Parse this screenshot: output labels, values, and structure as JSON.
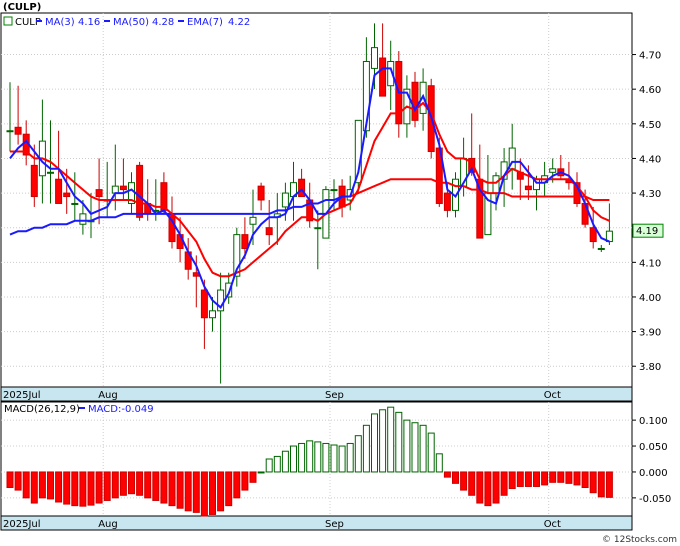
{
  "header": {
    "ticker": "(CULP)",
    "legend": [
      {
        "label": "CULP",
        "color": "#008000"
      },
      {
        "label": "MA(3)",
        "value": "4.16",
        "color": "#1a1aff"
      },
      {
        "label": "MA(50)",
        "value": "4.28",
        "color": "#1a1aff"
      },
      {
        "label": "EMA(7)",
        "value": "4.22",
        "color": "#1a1aff"
      }
    ]
  },
  "price_tag": "4.19",
  "macd_legend": {
    "label": "MACD(26,12,9)",
    "value_label": "MACD:-0.049"
  },
  "watermark": "© 12Stocks.com",
  "colors": {
    "up": "#006400",
    "down": "#ff0000",
    "ma_fast": "#1a1aff",
    "ema": "#ff0000",
    "macd_pos": "#006400",
    "macd_neg": "#ff0000",
    "tag_bg": "#d8ffd8",
    "axis_band": "#c8e6f0"
  },
  "chart_data": [
    {
      "type": "candlestick",
      "title": "(CULP)",
      "x_labels": [
        {
          "label": "2025Jul",
          "index": 0
        },
        {
          "label": "Aug",
          "index": 12
        },
        {
          "label": "Sep",
          "index": 40
        },
        {
          "label": "Oct",
          "index": 67
        }
      ],
      "ylim": [
        3.74,
        4.82
      ],
      "y_ticks": [
        3.8,
        3.9,
        4.0,
        4.1,
        4.2,
        4.3,
        4.4,
        4.5,
        4.6,
        4.7
      ],
      "ohlc": [
        [
          4.48,
          4.62,
          4.42,
          4.48
        ],
        [
          4.49,
          4.61,
          4.44,
          4.47
        ],
        [
          4.47,
          4.51,
          4.38,
          4.41
        ],
        [
          4.38,
          4.44,
          4.26,
          4.29
        ],
        [
          4.35,
          4.57,
          4.27,
          4.45
        ],
        [
          4.36,
          4.51,
          4.27,
          4.36
        ],
        [
          4.34,
          4.48,
          4.29,
          4.27
        ],
        [
          4.3,
          4.37,
          4.24,
          4.29
        ],
        [
          4.27,
          4.36,
          4.22,
          4.27
        ],
        [
          4.21,
          4.28,
          4.18,
          4.24
        ],
        [
          4.22,
          4.3,
          4.17,
          4.22
        ],
        [
          4.31,
          4.4,
          4.21,
          4.29
        ],
        [
          4.28,
          4.39,
          4.23,
          4.28
        ],
        [
          4.3,
          4.44,
          4.25,
          4.32
        ],
        [
          4.32,
          4.4,
          4.28,
          4.31
        ],
        [
          4.27,
          4.36,
          4.24,
          4.33
        ],
        [
          4.38,
          4.39,
          4.22,
          4.23
        ],
        [
          4.27,
          4.34,
          4.22,
          4.24
        ],
        [
          4.25,
          4.34,
          4.22,
          4.25
        ],
        [
          4.33,
          4.36,
          4.24,
          4.25
        ],
        [
          4.24,
          4.29,
          4.14,
          4.16
        ],
        [
          4.18,
          4.23,
          4.1,
          4.14
        ],
        [
          4.13,
          4.17,
          4.05,
          4.08
        ],
        [
          4.07,
          4.12,
          3.97,
          4.06
        ],
        [
          4.02,
          4.05,
          3.85,
          3.94
        ],
        [
          3.94,
          4.0,
          3.9,
          3.96
        ],
        [
          3.96,
          4.07,
          3.75,
          4.02
        ],
        [
          4.0,
          4.07,
          3.98,
          4.04
        ],
        [
          4.06,
          4.2,
          4.03,
          4.18
        ],
        [
          4.18,
          4.23,
          4.11,
          4.14
        ],
        [
          4.21,
          4.31,
          4.15,
          4.23
        ],
        [
          4.32,
          4.33,
          4.25,
          4.28
        ],
        [
          4.2,
          4.28,
          4.15,
          4.18
        ],
        [
          4.23,
          4.3,
          4.15,
          4.24
        ],
        [
          4.26,
          4.33,
          4.22,
          4.3
        ],
        [
          4.29,
          4.39,
          4.22,
          4.33
        ],
        [
          4.34,
          4.37,
          4.29,
          4.29
        ],
        [
          4.28,
          4.33,
          4.2,
          4.22
        ],
        [
          4.2,
          4.25,
          4.08,
          4.2
        ],
        [
          4.17,
          4.32,
          4.17,
          4.31
        ],
        [
          4.31,
          4.34,
          4.25,
          4.31
        ],
        [
          4.32,
          4.34,
          4.23,
          4.26
        ],
        [
          4.28,
          4.35,
          4.25,
          4.31
        ],
        [
          4.33,
          4.5,
          4.3,
          4.51
        ],
        [
          4.48,
          4.75,
          4.46,
          4.68
        ],
        [
          4.66,
          4.79,
          4.6,
          4.72
        ],
        [
          4.69,
          4.79,
          4.58,
          4.58
        ],
        [
          4.61,
          4.74,
          4.54,
          4.68
        ],
        [
          4.68,
          4.71,
          4.46,
          4.5
        ],
        [
          4.5,
          4.64,
          4.46,
          4.6
        ],
        [
          4.62,
          4.65,
          4.49,
          4.51
        ],
        [
          4.53,
          4.66,
          4.48,
          4.62
        ],
        [
          4.61,
          4.63,
          4.4,
          4.42
        ],
        [
          4.43,
          4.46,
          4.26,
          4.27
        ],
        [
          4.3,
          4.33,
          4.23,
          4.25
        ],
        [
          4.25,
          4.36,
          4.23,
          4.34
        ],
        [
          4.32,
          4.46,
          4.29,
          4.4
        ],
        [
          4.4,
          4.53,
          4.35,
          4.36
        ],
        [
          4.34,
          4.44,
          4.17,
          4.17
        ],
        [
          4.18,
          4.41,
          4.18,
          4.3
        ],
        [
          4.3,
          4.36,
          4.25,
          4.35
        ],
        [
          4.34,
          4.43,
          4.26,
          4.39
        ],
        [
          4.37,
          4.5,
          4.31,
          4.43
        ],
        [
          4.36,
          4.4,
          4.28,
          4.34
        ],
        [
          4.32,
          4.38,
          4.28,
          4.31
        ],
        [
          4.31,
          4.35,
          4.25,
          4.34
        ],
        [
          4.33,
          4.39,
          4.29,
          4.35
        ],
        [
          4.36,
          4.4,
          4.33,
          4.37
        ],
        [
          4.37,
          4.41,
          4.34,
          4.35
        ],
        [
          4.34,
          4.39,
          4.31,
          4.33
        ],
        [
          4.33,
          4.36,
          4.26,
          4.27
        ],
        [
          4.27,
          4.31,
          4.2,
          4.21
        ],
        [
          4.2,
          4.26,
          4.14,
          4.16
        ],
        [
          4.14,
          4.15,
          4.13,
          4.14
        ],
        [
          4.16,
          4.27,
          4.15,
          4.19
        ]
      ],
      "ma3": [
        4.4,
        4.43,
        4.45,
        4.42,
        4.39,
        4.37,
        4.37,
        4.33,
        4.29,
        4.27,
        4.24,
        4.25,
        4.26,
        4.3,
        4.3,
        4.31,
        4.29,
        4.27,
        4.24,
        4.25,
        4.22,
        4.18,
        4.13,
        4.09,
        4.03,
        3.99,
        3.97,
        4.01,
        4.08,
        4.12,
        4.18,
        4.21,
        4.23,
        4.23,
        4.24,
        4.29,
        4.31,
        4.28,
        4.24,
        4.24,
        4.27,
        4.29,
        4.29,
        4.36,
        4.5,
        4.64,
        4.66,
        4.66,
        4.59,
        4.59,
        4.54,
        4.58,
        4.52,
        4.44,
        4.31,
        4.29,
        4.33,
        4.37,
        4.31,
        4.28,
        4.27,
        4.35,
        4.39,
        4.39,
        4.36,
        4.33,
        4.33,
        4.35,
        4.36,
        4.35,
        4.32,
        4.27,
        4.21,
        4.17,
        4.16
      ],
      "ma50": [
        4.18,
        4.19,
        4.19,
        4.2,
        4.2,
        4.21,
        4.21,
        4.21,
        4.22,
        4.22,
        4.22,
        4.23,
        4.23,
        4.23,
        4.24,
        4.24,
        4.24,
        4.24,
        4.24,
        4.24,
        4.24,
        4.24,
        4.24,
        4.24,
        4.24,
        4.24,
        4.24,
        4.24,
        4.24,
        4.24,
        4.24,
        4.24,
        4.24,
        4.25,
        4.25,
        4.26,
        4.26,
        4.27,
        4.27,
        4.28,
        4.28,
        4.29,
        4.29,
        4.3,
        4.31,
        4.32,
        4.33,
        4.34,
        4.34,
        4.34,
        4.34,
        4.34,
        4.34,
        4.33,
        4.33,
        4.32,
        4.32,
        4.31,
        4.31,
        4.3,
        4.3,
        4.3,
        4.29,
        4.29,
        4.29,
        4.29,
        4.29,
        4.29,
        4.29,
        4.29,
        4.29,
        4.29,
        4.28,
        4.28,
        4.28
      ],
      "ema7": [
        4.42,
        4.42,
        4.42,
        4.4,
        4.4,
        4.39,
        4.37,
        4.35,
        4.33,
        4.31,
        4.29,
        4.28,
        4.28,
        4.28,
        4.28,
        4.28,
        4.27,
        4.27,
        4.26,
        4.26,
        4.24,
        4.22,
        4.19,
        4.16,
        4.11,
        4.07,
        4.06,
        4.06,
        4.07,
        4.08,
        4.1,
        4.12,
        4.14,
        4.16,
        4.19,
        4.21,
        4.23,
        4.23,
        4.22,
        4.24,
        4.25,
        4.26,
        4.27,
        4.31,
        4.38,
        4.45,
        4.49,
        4.53,
        4.53,
        4.55,
        4.54,
        4.56,
        4.53,
        4.47,
        4.42,
        4.4,
        4.4,
        4.39,
        4.34,
        4.33,
        4.33,
        4.35,
        4.37,
        4.36,
        4.35,
        4.34,
        4.34,
        4.34,
        4.34,
        4.34,
        4.32,
        4.29,
        4.25,
        4.23,
        4.22
      ]
    },
    {
      "type": "bar",
      "title": "MACD(26,12,9)",
      "ylim": [
        -0.085,
        0.135
      ],
      "y_ticks": [
        -0.05,
        0.0,
        0.05,
        0.1
      ],
      "y_tick_labels": [
        "-0.050",
        "0.000",
        "0.050",
        "0.100"
      ],
      "values": [
        -0.03,
        -0.035,
        -0.05,
        -0.06,
        -0.05,
        -0.052,
        -0.058,
        -0.062,
        -0.065,
        -0.066,
        -0.064,
        -0.06,
        -0.055,
        -0.05,
        -0.045,
        -0.042,
        -0.045,
        -0.05,
        -0.055,
        -0.06,
        -0.065,
        -0.07,
        -0.075,
        -0.078,
        -0.085,
        -0.082,
        -0.075,
        -0.065,
        -0.05,
        -0.035,
        -0.02,
        0.0,
        0.025,
        0.03,
        0.04,
        0.05,
        0.055,
        0.06,
        0.058,
        0.055,
        0.052,
        0.05,
        0.055,
        0.07,
        0.09,
        0.112,
        0.12,
        0.125,
        0.115,
        0.1,
        0.095,
        0.09,
        0.075,
        0.035,
        -0.01,
        -0.022,
        -0.035,
        -0.045,
        -0.06,
        -0.065,
        -0.06,
        -0.045,
        -0.032,
        -0.028,
        -0.028,
        -0.028,
        -0.025,
        -0.02,
        -0.02,
        -0.022,
        -0.025,
        -0.03,
        -0.04,
        -0.048,
        -0.049
      ]
    }
  ]
}
